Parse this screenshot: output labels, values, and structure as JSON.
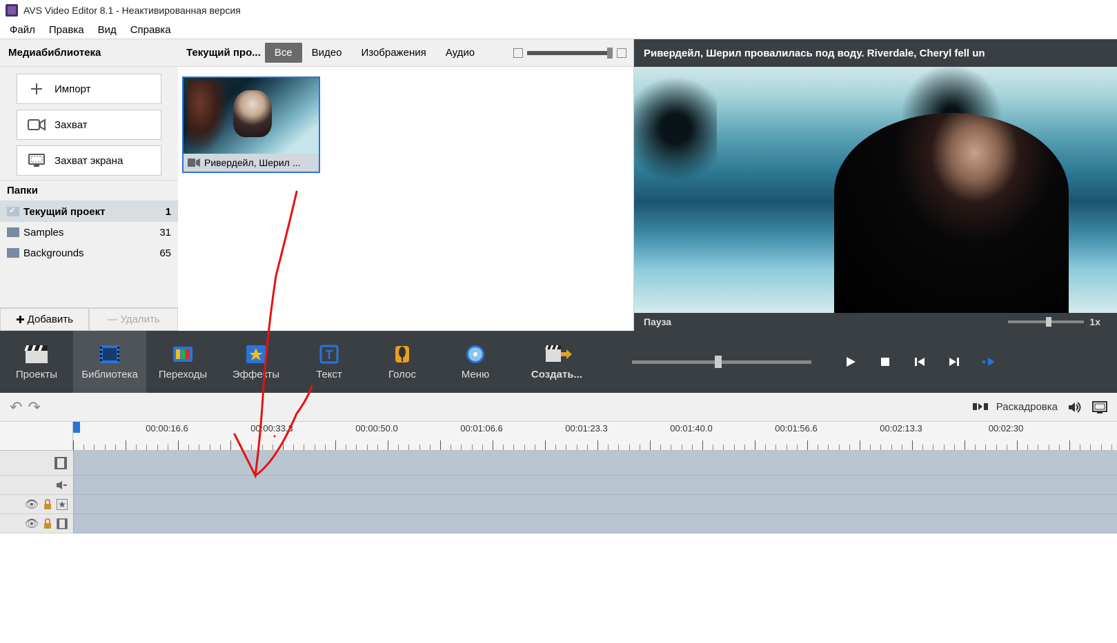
{
  "title": "AVS Video Editor 8.1 - Неактивированная версия",
  "menu": {
    "file": "Файл",
    "edit": "Правка",
    "view": "Вид",
    "help": "Справка"
  },
  "sidebar": {
    "header": "Медиабиблиотека",
    "import": "Импорт",
    "capture": "Захват",
    "screencap": "Захват экрана",
    "folders_label": "Папки",
    "folders": [
      {
        "name": "Текущий проект",
        "count": "1",
        "active": true
      },
      {
        "name": "Samples",
        "count": "31",
        "active": false
      },
      {
        "name": "Backgrounds",
        "count": "65",
        "active": false
      }
    ],
    "add": "Добавить",
    "remove": "Удалить"
  },
  "media": {
    "label": "Текущий про...",
    "tabs": {
      "all": "Все",
      "video": "Видео",
      "images": "Изображения",
      "audio": "Аудио"
    },
    "clip_name": "Ривердейл, Шерил ..."
  },
  "preview": {
    "title": "Ривердейл, Шерил провалилась под воду. Riverdale, Cheryl fell un",
    "status": "Пауза",
    "speed": "1x"
  },
  "toolbar": {
    "projects": "Проекты",
    "library": "Библиотека",
    "transitions": "Переходы",
    "effects": "Эффекты",
    "text": "Текст",
    "voice": "Голос",
    "menu": "Меню",
    "produce": "Создать..."
  },
  "timeline": {
    "storyboard": "Раскадровка",
    "times": [
      "00:00:16.6",
      "00:00:33.3",
      "00:00:50.0",
      "00:01:06.6",
      "00:01:23.3",
      "00:01:40.0",
      "00:01:56.6",
      "00:02:13.3",
      "00:02:30"
    ]
  }
}
